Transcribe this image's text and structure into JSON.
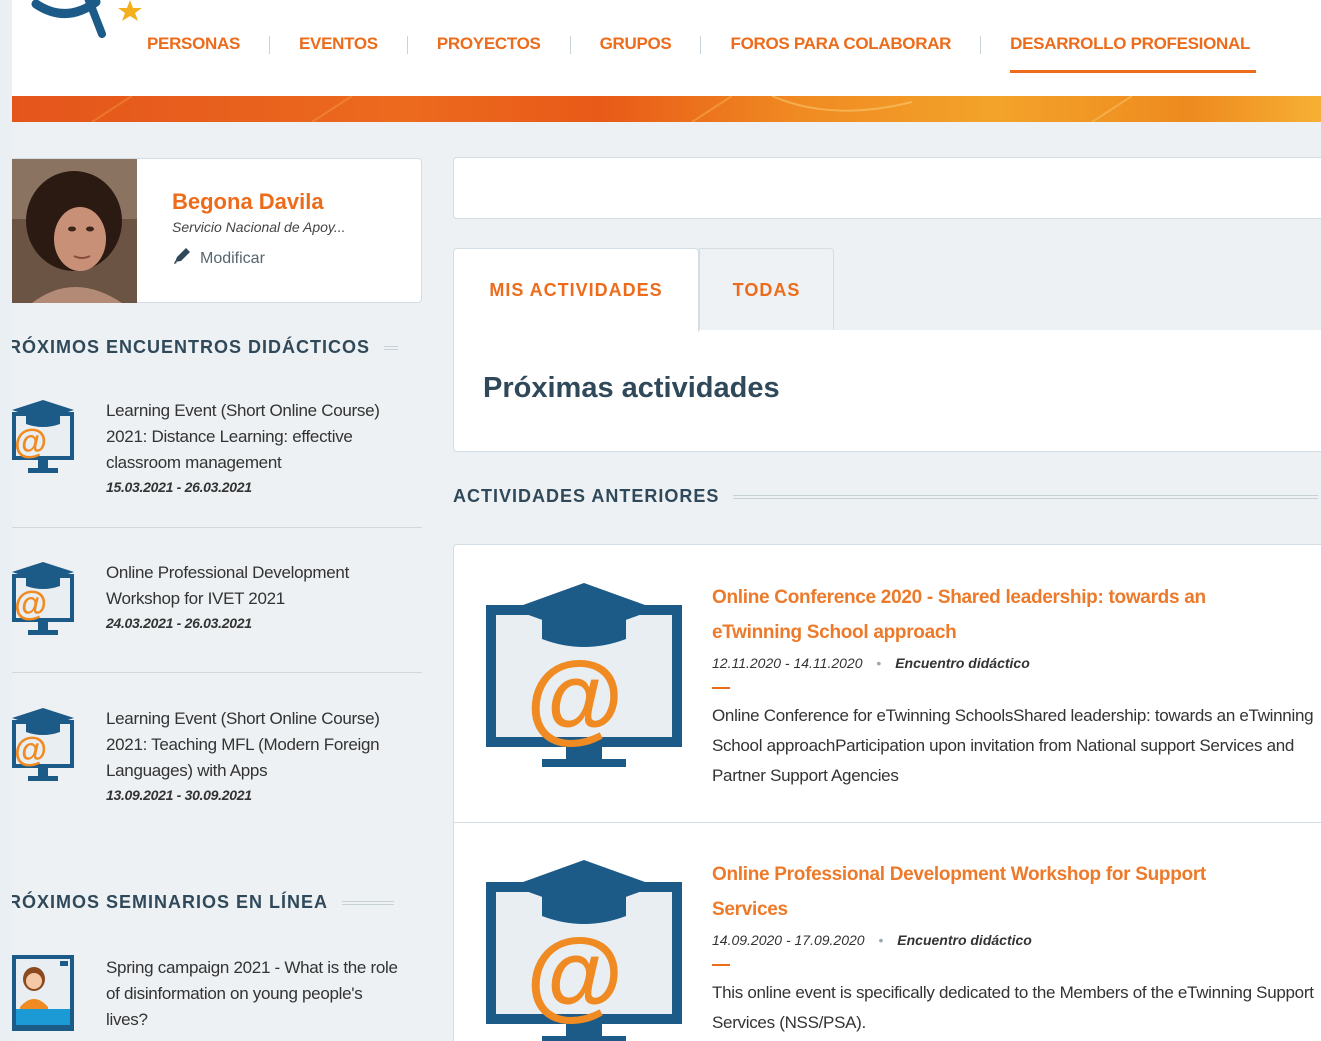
{
  "nav": {
    "items": [
      "PERSONAS",
      "EVENTOS",
      "PROYECTOS",
      "GRUPOS",
      "FOROS PARA COLABORAR",
      "DESARROLLO PROFESIONAL"
    ],
    "active": "DESARROLLO PROFESIONAL"
  },
  "profile": {
    "name": "Begona Davila",
    "organization": "Servicio Nacional de Apoy...",
    "edit_label": "Modificar"
  },
  "sidebar": {
    "learning_events_heading": "RÓXIMOS ENCUENTROS DIDÁCTICOS",
    "learning_events": [
      {
        "title": "Learning Event (Short Online Course) 2021: Distance Learning: effective classroom management",
        "date": "15.03.2021 - 26.03.2021"
      },
      {
        "title": "Online Professional Development Workshop for IVET 2021",
        "date": "24.03.2021 - 26.03.2021"
      },
      {
        "title": "Learning Event (Short Online Course) 2021: Teaching MFL (Modern Foreign Languages) with Apps",
        "date": "13.09.2021 - 30.09.2021"
      }
    ],
    "webinars_heading": "RÓXIMOS SEMINARIOS EN LÍNEA",
    "webinars": [
      {
        "title": "Spring campaign 2021 - What is the role of disinformation on young people's lives?"
      }
    ]
  },
  "main": {
    "tabs": [
      "MIS ACTIVIDADES",
      "TODAS"
    ],
    "active_tab": "MIS ACTIVIDADES",
    "upcoming_title": "Próximas actividades",
    "past_heading": "ACTIVIDADES ANTERIORES",
    "past_activities": [
      {
        "title": "Online Conference 2020 - Shared leadership: towards an eTwinning School approach",
        "date": "12.11.2020 - 14.11.2020",
        "separator": "•",
        "type": "Encuentro didáctico",
        "description": "Online Conference for eTwinning SchoolsShared leadership: towards an eTwinning School approachParticipation upon invitation from National support Services and Partner Support Agencies"
      },
      {
        "title": "Online Professional Development Workshop for Support Services",
        "date": "14.09.2020 - 17.09.2020",
        "separator": "•",
        "type": "Encuentro didáctico",
        "description": "This online event is specifically dedicated to the Members of the eTwinning Support Services (NSS/PSA)."
      }
    ]
  },
  "colors": {
    "accent": "#ec6c1c",
    "heading": "#30495a",
    "icon_blue": "#1c5a87",
    "icon_light": "#e8eef2"
  }
}
